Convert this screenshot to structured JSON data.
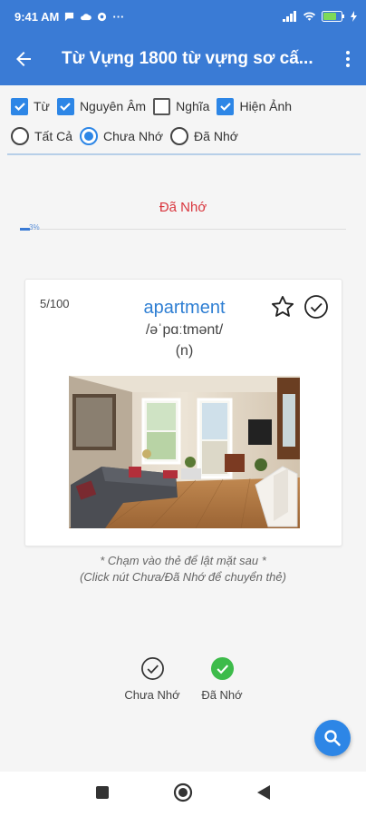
{
  "status_bar": {
    "time": "9:41 AM",
    "dots": "···",
    "battery": "62"
  },
  "app_bar": {
    "title": "Từ Vựng 1800 từ vựng sơ cấ..."
  },
  "filters": {
    "checkboxes": [
      {
        "label": "Từ",
        "checked": true
      },
      {
        "label": "Nguyên Âm",
        "checked": true
      },
      {
        "label": "Nghĩa",
        "checked": false
      },
      {
        "label": "Hiện Ảnh",
        "checked": true
      }
    ],
    "radios": [
      {
        "label": "Tất Cả",
        "selected": false
      },
      {
        "label": "Chưa Nhớ",
        "selected": true
      },
      {
        "label": "Đã Nhớ",
        "selected": false
      }
    ]
  },
  "status": {
    "label": "Đã Nhớ"
  },
  "progress": {
    "label": "3%",
    "value": 3
  },
  "card": {
    "counter": "5/100",
    "word": "apartment",
    "phonetic": "/əˈpɑːtmənt/",
    "part_of_speech": "(n)"
  },
  "hint": {
    "line1": "* Chạm vào thẻ để lật mặt sau *",
    "line2": "(Click nút Chưa/Đã Nhớ để chuyển thẻ)"
  },
  "actions": {
    "not_yet": "Chưa Nhớ",
    "done": "Đã Nhớ"
  },
  "colors": {
    "primary": "#3a7bd5",
    "accent": "#2d86e6",
    "remembered": "#d9363e",
    "success": "#3dbb4a"
  }
}
